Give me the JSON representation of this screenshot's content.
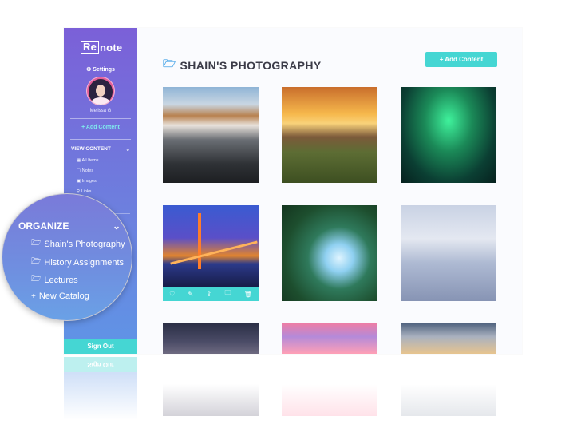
{
  "sidebar": {
    "logo_box": "Re",
    "logo_rest": "note",
    "settings_label": "Settings",
    "user_name": "Melissa G",
    "add_content": "+ Add Content",
    "view_content_label": "VIEW CONTENT",
    "view_items": [
      {
        "icon": "grid-icon",
        "glyph": "▦",
        "label": "All Items"
      },
      {
        "icon": "note-icon",
        "glyph": "▢",
        "label": "Notes"
      },
      {
        "icon": "image-icon",
        "glyph": "▣",
        "label": "Images"
      },
      {
        "icon": "link-icon",
        "glyph": "⚲",
        "label": "Links"
      }
    ],
    "sign_out": "Sign Out"
  },
  "main": {
    "title": "SHAIN'S PHOTOGRAPHY",
    "add_button": "+ Add Content",
    "tile_actions": [
      "heart-icon",
      "edit-icon",
      "share-icon",
      "folder-icon",
      "trash-icon"
    ]
  },
  "magnifier": {
    "heading": "ORGANIZE",
    "items": [
      {
        "icon": "folder-icon",
        "glyph": "🗁",
        "label": "Shain's Photography"
      },
      {
        "icon": "folder-icon",
        "glyph": "🗁",
        "label": "History Assignments"
      },
      {
        "icon": "folder-icon",
        "glyph": "🗁",
        "label": "Lectures"
      },
      {
        "icon": "plus-icon",
        "glyph": "+",
        "label": "New Catalog"
      }
    ]
  },
  "colors": {
    "accent_teal": "#45d6d3",
    "sidebar_top": "#7b60d8",
    "sidebar_bottom": "#5f95e6",
    "title_text": "#3b3b48"
  }
}
